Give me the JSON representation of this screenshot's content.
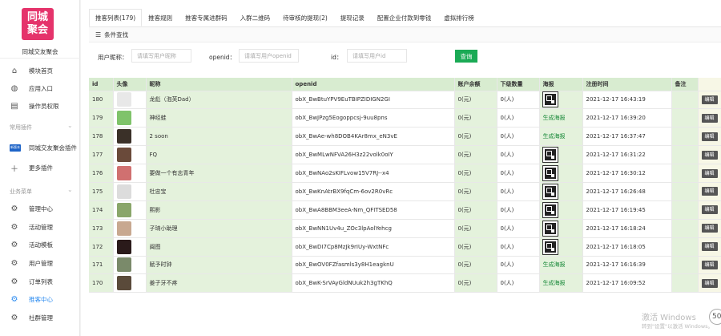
{
  "app": {
    "logo_line1": "同城",
    "logo_line2": "聚会",
    "name": "同城交友聚会"
  },
  "sidebar": {
    "top_items": [
      {
        "label": "模块首页",
        "icon": "home-icon"
      },
      {
        "label": "应用入口",
        "icon": "chat-icon"
      },
      {
        "label": "操作员权限",
        "icon": "document-icon"
      }
    ],
    "section_plugins": "常用插件",
    "plugin_items": [
      {
        "label": "同城交友聚会插件",
        "badge": "新版本"
      },
      {
        "label": "更多插件",
        "icon": "plus-icon"
      }
    ],
    "section_business": "业务菜单",
    "business_items": [
      {
        "label": "管理中心"
      },
      {
        "label": "活动管理"
      },
      {
        "label": "活动模板"
      },
      {
        "label": "用户管理"
      },
      {
        "label": "订单列表"
      },
      {
        "label": "推客中心"
      },
      {
        "label": "社群管理"
      }
    ]
  },
  "tabs": [
    {
      "label": "推客列表(179)",
      "active": true
    },
    {
      "label": "推客规则"
    },
    {
      "label": "推客专属进群码"
    },
    {
      "label": "入群二维码"
    },
    {
      "label": "待审核的提现(2)"
    },
    {
      "label": "提现记录"
    },
    {
      "label": "配置企业付款到零钱"
    },
    {
      "label": "虚拟排行榜"
    }
  ],
  "filter": {
    "title": "条件查找",
    "nickname_label": "用户昵称：",
    "nickname_placeholder": "请填写用户昵称",
    "openid_label": "openid：",
    "openid_placeholder": "请填写用户openid",
    "id_label": "id：",
    "id_placeholder": "请填写用户id",
    "query_button": "查询"
  },
  "table": {
    "columns": [
      "id",
      "头像",
      "昵称",
      "openid",
      "账户余额",
      "下级数量",
      "海报",
      "注册时间",
      "备注",
      ""
    ],
    "edit_label": "编辑",
    "generate_label": "生成海报",
    "rows": [
      {
        "id": "180",
        "nickname": "龙彪（泡芙Dad）",
        "openid": "obX_BwBtuYPV9EuTBIPZIDIGN2GI",
        "balance": "0(元)",
        "subs": "0(人)",
        "poster": "qr",
        "time": "2021-12-17 16:43:19",
        "avatar_color": "#e8e8e8"
      },
      {
        "id": "179",
        "nickname": "神经蛙",
        "openid": "obX_BwJPzg5Eogoppcsj-9uu8pns",
        "balance": "0(元)",
        "subs": "0(人)",
        "poster": "gen",
        "time": "2021-12-17 16:39:20",
        "avatar_color": "#7fc36a"
      },
      {
        "id": "178",
        "nickname": "2 soon",
        "openid": "obX_BwAe-wh8DOB4KAr8mx_eN3vE",
        "balance": "0(元)",
        "subs": "0(人)",
        "poster": "gen",
        "time": "2021-12-17 16:37:47",
        "avatar_color": "#3a3028"
      },
      {
        "id": "177",
        "nickname": "FQ",
        "openid": "obX_BwMLwNFVA26H3z22volk0oIY",
        "balance": "0(元)",
        "subs": "0(人)",
        "poster": "qr",
        "time": "2021-12-17 16:31:22",
        "avatar_color": "#6a4a3a"
      },
      {
        "id": "176",
        "nickname": "要做一个有志青年",
        "openid": "obX_BwNAo2sKIFLvow15V7RJ--x4",
        "balance": "0(元)",
        "subs": "0(人)",
        "poster": "qr",
        "time": "2021-12-17 16:30:12",
        "avatar_color": "#d07070"
      },
      {
        "id": "175",
        "nickname": "杜忠宝",
        "openid": "obX_BwKnAtrBX9fqCm-6ov2R0vRc",
        "balance": "0(元)",
        "subs": "0(人)",
        "poster": "qr",
        "time": "2021-12-17 16:26:48",
        "avatar_color": "#dcdcdc"
      },
      {
        "id": "174",
        "nickname": "熙影",
        "openid": "obX_BwA8BBM3eeA-Nm_QFITSED58",
        "balance": "0(元)",
        "subs": "0(人)",
        "poster": "qr",
        "time": "2021-12-17 16:19:45",
        "avatar_color": "#8aa66a"
      },
      {
        "id": "173",
        "nickname": "子琦小助理",
        "openid": "obX_BwNN1Uv4u_ZOc3lpAolYehcg",
        "balance": "0(元)",
        "subs": "0(人)",
        "poster": "qr",
        "time": "2021-12-17 16:18:24",
        "avatar_color": "#c8a890"
      },
      {
        "id": "172",
        "nickname": "闽图",
        "openid": "obX_BwDI7Cp8MzJk9rIUy-WxtNFc",
        "balance": "0(元)",
        "subs": "0(人)",
        "poster": "qr",
        "time": "2021-12-17 16:18:05",
        "avatar_color": "#2a1a1a"
      },
      {
        "id": "171",
        "nickname": "赋予时钟",
        "openid": "obX_BwOV0FZfasmls3y8H1eagknU",
        "balance": "0(元)",
        "subs": "0(人)",
        "poster": "gen",
        "time": "2021-12-17 16:16:39",
        "avatar_color": "#7a8a6a"
      },
      {
        "id": "170",
        "nickname": "姜子牙不疼",
        "openid": "obX_BwK-SrVAyGldNUuk2h3gTKhQ",
        "balance": "0(元)",
        "subs": "0(人)",
        "poster": "gen",
        "time": "2021-12-17 16:09:52",
        "avatar_color": "#5a4a3a"
      }
    ]
  },
  "watermark": {
    "line1": "激活 Windows",
    "line2": "转到\"设置\"以激活 Windows。",
    "badge": "50"
  }
}
